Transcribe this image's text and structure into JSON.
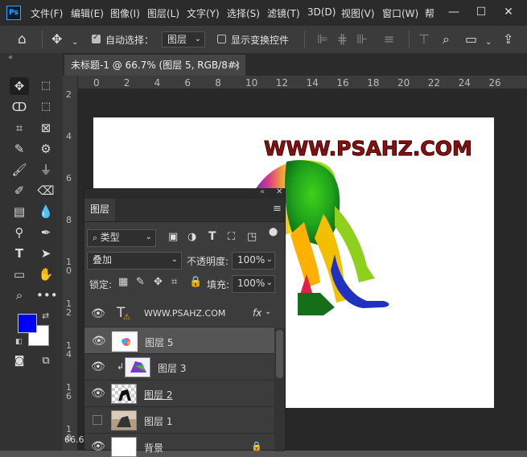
{
  "app": {
    "logo": "Ps"
  },
  "menu": [
    "文件(F)",
    "编辑(E)",
    "图像(I)",
    "图层(L)",
    "文字(Y)",
    "选择(S)",
    "滤镜(T)",
    "3D(D)",
    "视图(V)",
    "窗口(W)",
    "帮"
  ],
  "window_controls": {
    "minimize": "—",
    "maximize": "☐",
    "close": "✕"
  },
  "options": {
    "auto_select_label": "自动选择：",
    "auto_select_checked": true,
    "auto_select_value": "图层",
    "show_transform_label": "显示变换控件",
    "show_transform_checked": false
  },
  "document": {
    "tab_title": "未标题-1 @ 66.7% (图层 5, RGB/8#) *",
    "tab_close": "×",
    "zoom_readout": "66.6"
  },
  "ruler_h": [
    "0",
    "2",
    "4",
    "6",
    "8",
    "10",
    "12",
    "14",
    "16",
    "18",
    "20",
    "22",
    "24",
    "26"
  ],
  "ruler_v": [
    "2",
    "4",
    "6",
    "8",
    "1\n0",
    "1\n2",
    "1\n4",
    "1\n6",
    "1\n8"
  ],
  "canvas": {
    "watermark_text": "WWW.PSAHZ.COM"
  },
  "colors": {
    "foreground": "#0000ff",
    "background": "#ffffff"
  },
  "layers_panel": {
    "title": "图层",
    "filter_label": "类型",
    "blend_mode": "叠加",
    "opacity_label": "不透明度:",
    "opacity_value": "100%",
    "lock_label": "锁定:",
    "fill_label": "填充:",
    "fill_value": "100%",
    "layers": [
      {
        "name": "WWW.PSAHZ.COM",
        "type": "text",
        "visible": true,
        "fx": "fx"
      },
      {
        "name": "图层 5",
        "type": "pixel",
        "visible": true,
        "selected": true
      },
      {
        "name": "图层 3",
        "type": "pixel",
        "visible": true,
        "clipped": true
      },
      {
        "name": "图层 2",
        "type": "pixel",
        "visible": true
      },
      {
        "name": "图层 1",
        "type": "pixel",
        "visible": false
      },
      {
        "name": "背景",
        "type": "background",
        "visible": true,
        "locked": true
      }
    ]
  }
}
